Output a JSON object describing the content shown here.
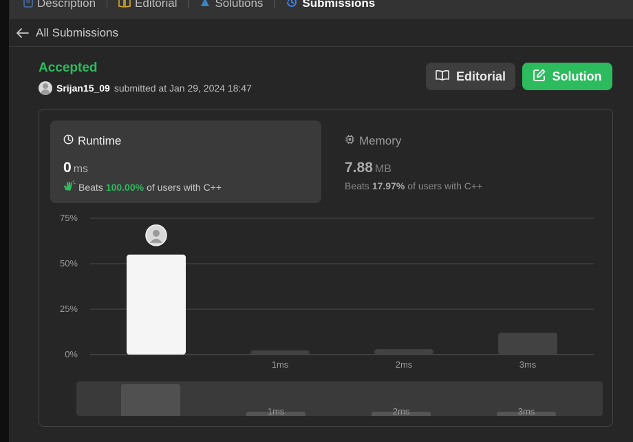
{
  "tabs": [
    {
      "label": "Description",
      "icon": "document-icon",
      "color": "#4a6fa5"
    },
    {
      "label": "Editorial",
      "icon": "book-icon",
      "color": "#d4a72c"
    },
    {
      "label": "Solutions",
      "icon": "flask-icon",
      "color": "#3b82c4"
    },
    {
      "label": "Submissions",
      "icon": "history-icon",
      "color": "#3b82f6",
      "active": true
    }
  ],
  "subheader": {
    "back_label": "All Submissions"
  },
  "submission": {
    "status": "Accepted",
    "username": "Srijan15_09",
    "submitted_text": "submitted at Jan 29, 2024 18:47"
  },
  "buttons": {
    "editorial": "Editorial",
    "solution": "Solution"
  },
  "runtime": {
    "title": "Runtime",
    "value": "0",
    "unit": "ms",
    "beats_prefix": "Beats",
    "beats_pct": "100.00%",
    "beats_suffix": "of users with C++"
  },
  "memory": {
    "title": "Memory",
    "value": "7.88",
    "unit": "MB",
    "beats_prefix": "Beats",
    "beats_pct": "17.97%",
    "beats_suffix": "of users with C++"
  },
  "colors": {
    "accent_green": "#2cbb5d",
    "bar_highlight": "#f5f5f5",
    "bar_other": "#424242"
  },
  "chart_data": {
    "type": "bar",
    "categories": [
      "0ms",
      "1ms",
      "2ms",
      "3ms"
    ],
    "tick_labels": [
      "",
      "1ms",
      "2ms",
      "3ms"
    ],
    "values": [
      55,
      2,
      3,
      12
    ],
    "ylim": [
      0,
      75
    ],
    "yticks": [
      "0%",
      "25%",
      "50%",
      "75%"
    ],
    "ytick_values": [
      0,
      25,
      50,
      75
    ],
    "highlight_index": 0,
    "grid": true,
    "overview_values": [
      55,
      2,
      3,
      4
    ]
  }
}
